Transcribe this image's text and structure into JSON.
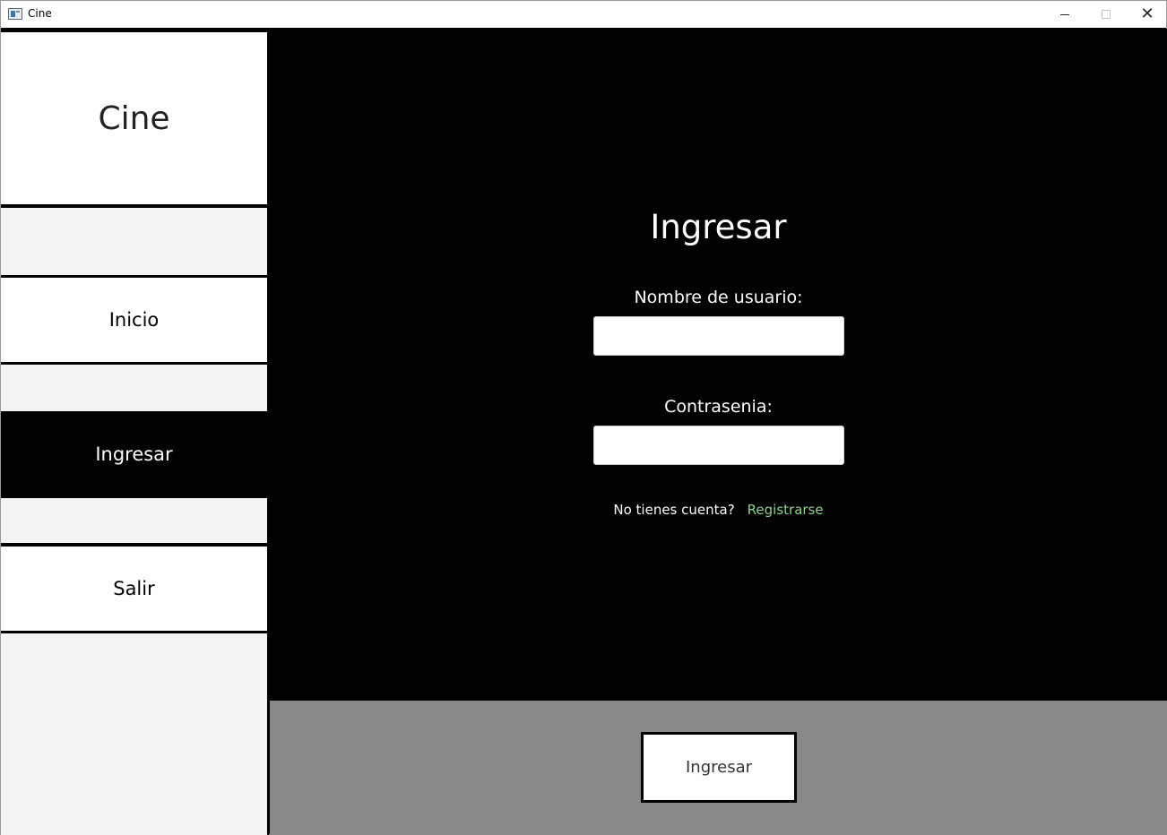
{
  "window": {
    "title": "Cine",
    "controls": [
      "minimize-icon",
      "maximize-icon",
      "close-icon"
    ],
    "close_glyph": "✕"
  },
  "sidebar": {
    "brand": "Cine",
    "items": [
      {
        "label": "Inicio",
        "active": false
      },
      {
        "label": "Ingresar",
        "active": true
      },
      {
        "label": "Salir",
        "active": false
      }
    ]
  },
  "form": {
    "title": "Ingresar",
    "username_label": "Nombre de usuario:",
    "username_value": "",
    "password_label": "Contrasenia:",
    "password_value": "",
    "no_account_text": "No tienes cuenta?",
    "register_link": "Registrarse"
  },
  "footer": {
    "submit_label": "Ingresar"
  },
  "colors": {
    "main_bg": "#000000",
    "sidebar_gap_bg": "#f3f3f3",
    "footer_bg": "#8a8787",
    "link": "#8fcf8f"
  }
}
